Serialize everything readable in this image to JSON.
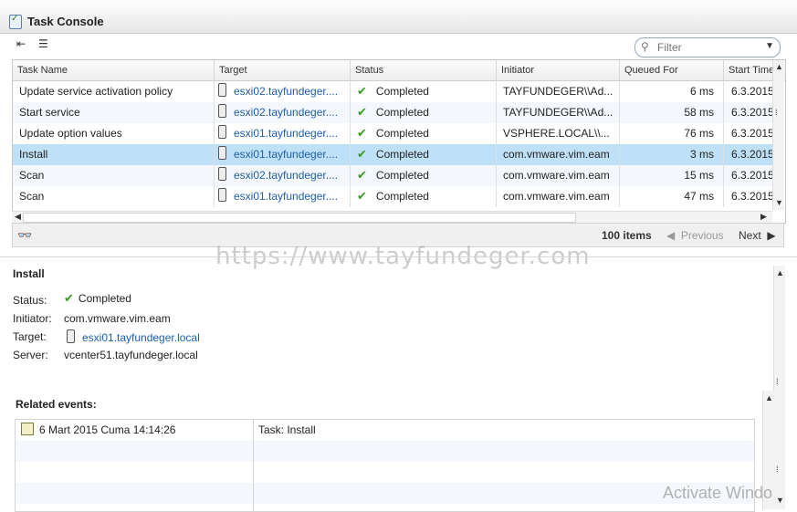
{
  "window": {
    "title": "Task Console"
  },
  "toolbar": {
    "filter_placeholder": "Filter"
  },
  "grid": {
    "columns": [
      "Task Name",
      "Target",
      "Status",
      "Initiator",
      "Queued For",
      "Start Time"
    ],
    "rows": [
      {
        "task": "Update service activation policy",
        "target": "esxi02.tayfundeger....",
        "status": "Completed",
        "initiator": "TAYFUNDEGER\\\\Ad...",
        "queued": "6 ms",
        "start": "6.3.2015"
      },
      {
        "task": "Start service",
        "target": "esxi02.tayfundeger....",
        "status": "Completed",
        "initiator": "TAYFUNDEGER\\\\Ad...",
        "queued": "58 ms",
        "start": "6.3.2015"
      },
      {
        "task": "Update option values",
        "target": "esxi01.tayfundeger....",
        "status": "Completed",
        "initiator": "VSPHERE.LOCAL\\\\...",
        "queued": "76 ms",
        "start": "6.3.2015"
      },
      {
        "task": "Install",
        "target": "esxi01.tayfundeger....",
        "status": "Completed",
        "initiator": "com.vmware.vim.eam",
        "queued": "3 ms",
        "start": "6.3.2015"
      },
      {
        "task": "Scan",
        "target": "esxi02.tayfundeger....",
        "status": "Completed",
        "initiator": "com.vmware.vim.eam",
        "queued": "15 ms",
        "start": "6.3.2015"
      },
      {
        "task": "Scan",
        "target": "esxi01.tayfundeger....",
        "status": "Completed",
        "initiator": "com.vmware.vim.eam",
        "queued": "47 ms",
        "start": "6.3.2015"
      }
    ]
  },
  "pager": {
    "count": "100 items",
    "previous": "Previous",
    "next": "Next"
  },
  "watermark": "https://www.tayfundeger.com",
  "details": {
    "title": "Install",
    "status_label": "Status:",
    "status_value": "Completed",
    "initiator_label": "Initiator:",
    "initiator_value": "com.vmware.vim.eam",
    "target_label": "Target:",
    "target_value": "esxi01.tayfundeger.local",
    "server_label": "Server:",
    "server_value": "vcenter51.tayfundeger.local",
    "related_label": "Related events:",
    "events": [
      {
        "time": "6 Mart 2015 Cuma 14:14:26",
        "description": "Task: Install"
      }
    ]
  },
  "os_watermark": "Activate Windo"
}
